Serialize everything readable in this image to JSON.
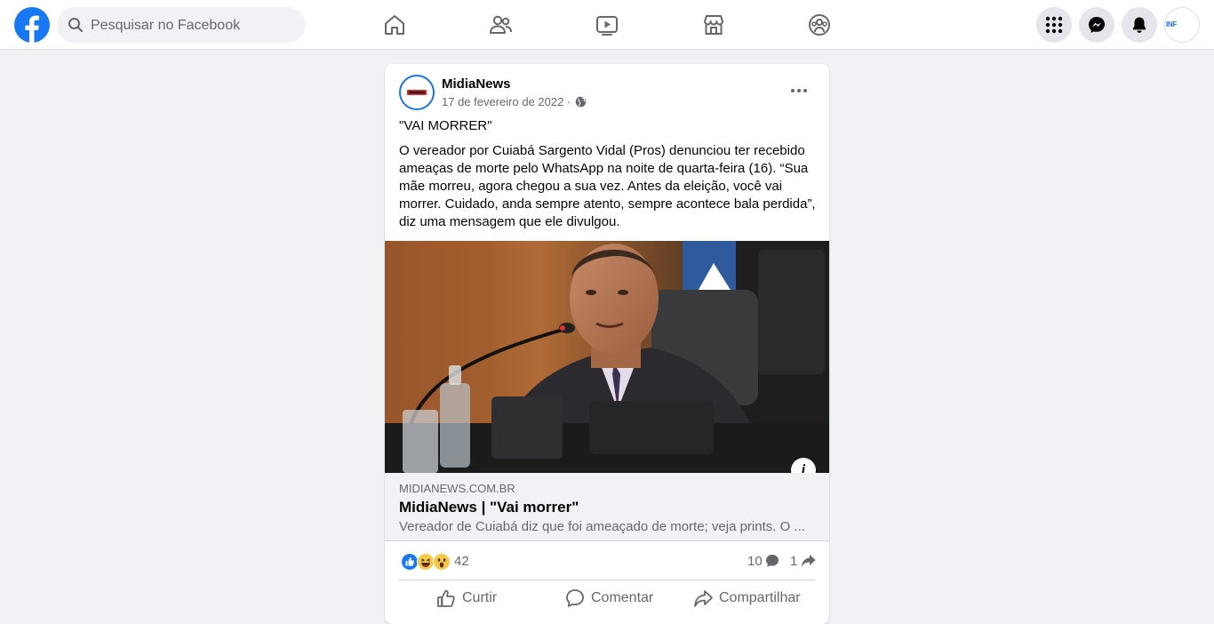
{
  "topbar": {
    "search_placeholder": "Pesquisar no Facebook",
    "profile_avatar_text": "INF",
    "accent": "#1877f2"
  },
  "post": {
    "page_name": "MidiaNews",
    "date": "17 de fevereiro de 2022 ·",
    "headline": "\"VAI MORRER\"",
    "body": "O vereador por Cuiabá Sargento Vidal (Pros) denunciou ter recebido ameaças de morte pelo WhatsApp na noite de quarta-feira (16). “Sua mãe morreu, agora chegou a sua vez. Antes da eleição, você vai morrer. Cuidado, anda sempre atento, sempre acontece bala perdida”, diz uma mensagem que ele divulgou.",
    "info_label": "i",
    "link": {
      "domain": "MIDIANEWS.COM.BR",
      "title": "MidiaNews | \"Vai morrer\"",
      "description": "Vereador de Cuiabá diz que foi ameaçado de morte; veja prints. O ..."
    },
    "stats": {
      "reactions": "42",
      "comments": "10",
      "shares": "1"
    },
    "actions": {
      "like": "Curtir",
      "comment": "Comentar",
      "share": "Compartilhar"
    }
  }
}
